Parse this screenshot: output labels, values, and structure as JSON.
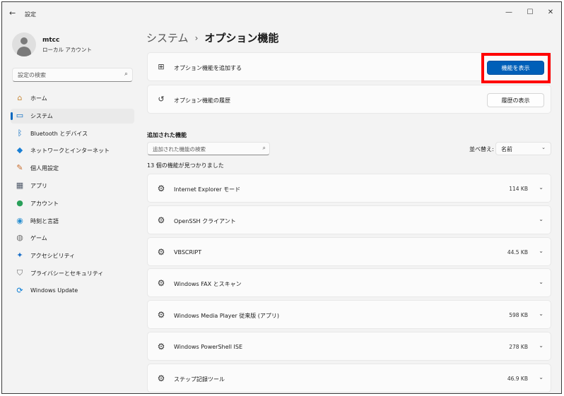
{
  "window": {
    "title": "設定",
    "back_icon": "←",
    "minimize": "—",
    "maximize": "☐",
    "close": "✕"
  },
  "user": {
    "name": "mtcc",
    "account_type": "ローカル アカウント"
  },
  "search": {
    "placeholder": "設定の検索",
    "icon": "⌕"
  },
  "sidebar": {
    "items": [
      {
        "label": "ホーム",
        "icon": "home-icon",
        "glyph": "⌂",
        "color": "#c98a3a",
        "active": false
      },
      {
        "label": "システム",
        "icon": "system-icon",
        "glyph": "▭",
        "color": "#0067c0",
        "active": true
      },
      {
        "label": "Bluetooth とデバイス",
        "icon": "bluetooth-icon",
        "glyph": "ᛒ",
        "color": "#0067c0",
        "active": false
      },
      {
        "label": "ネットワークとインターネット",
        "icon": "network-icon",
        "glyph": "◆",
        "color": "#1a7fd4",
        "active": false
      },
      {
        "label": "個人用設定",
        "icon": "brush-icon",
        "glyph": "✎",
        "color": "#c86a2a",
        "active": false
      },
      {
        "label": "アプリ",
        "icon": "apps-icon",
        "glyph": "▦",
        "color": "#505a6a",
        "active": false
      },
      {
        "label": "アカウント",
        "icon": "account-icon",
        "glyph": "●",
        "color": "#2aa05a",
        "active": false
      },
      {
        "label": "時刻と言語",
        "icon": "time-language-icon",
        "glyph": "◉",
        "color": "#2a8fd0",
        "active": false
      },
      {
        "label": "ゲーム",
        "icon": "gaming-icon",
        "glyph": "◍",
        "color": "#707070",
        "active": false
      },
      {
        "label": "アクセシビリティ",
        "icon": "accessibility-icon",
        "glyph": "✦",
        "color": "#1a6fc8",
        "active": false
      },
      {
        "label": "プライバシーとセキュリティ",
        "icon": "shield-icon",
        "glyph": "⛉",
        "color": "#6a6a6a",
        "active": false
      },
      {
        "label": "Windows Update",
        "icon": "windows-update-icon",
        "glyph": "⟳",
        "color": "#0078d4",
        "active": false
      }
    ]
  },
  "header": {
    "parent": "システム",
    "separator": "›",
    "current": "オプション機能"
  },
  "add_card": {
    "icon": "add-feature-icon",
    "glyph": "⊞",
    "label": "オプション機能を追加する",
    "button": "機能を表示"
  },
  "history_card": {
    "icon": "history-icon",
    "glyph": "↺",
    "label": "オプション機能の履歴",
    "button": "履歴の表示"
  },
  "features": {
    "section_title": "追加された機能",
    "search_placeholder": "追加された機能の検索",
    "search_icon": "⌕",
    "sort_label": "並べ替え:",
    "sort_value": "名前",
    "sort_chevron": "⌄",
    "count_text": "13 個の機能が見つかりました",
    "item_glyph": "⚙",
    "item_chevron": "⌄",
    "items": [
      {
        "name": "Internet Explorer モード",
        "size": "114 KB"
      },
      {
        "name": "OpenSSH クライアント",
        "size": ""
      },
      {
        "name": "VBSCRIPT",
        "size": "44.5 KB"
      },
      {
        "name": "Windows FAX とスキャン",
        "size": ""
      },
      {
        "name": "Windows Media Player 従来版 (アプリ)",
        "size": "598 KB"
      },
      {
        "name": "Windows PowerShell ISE",
        "size": "278 KB"
      },
      {
        "name": "ステップ記録ツール",
        "size": "46.9 KB"
      }
    ]
  },
  "highlight_color": "#ff0000",
  "accent_color": "#005fb8"
}
